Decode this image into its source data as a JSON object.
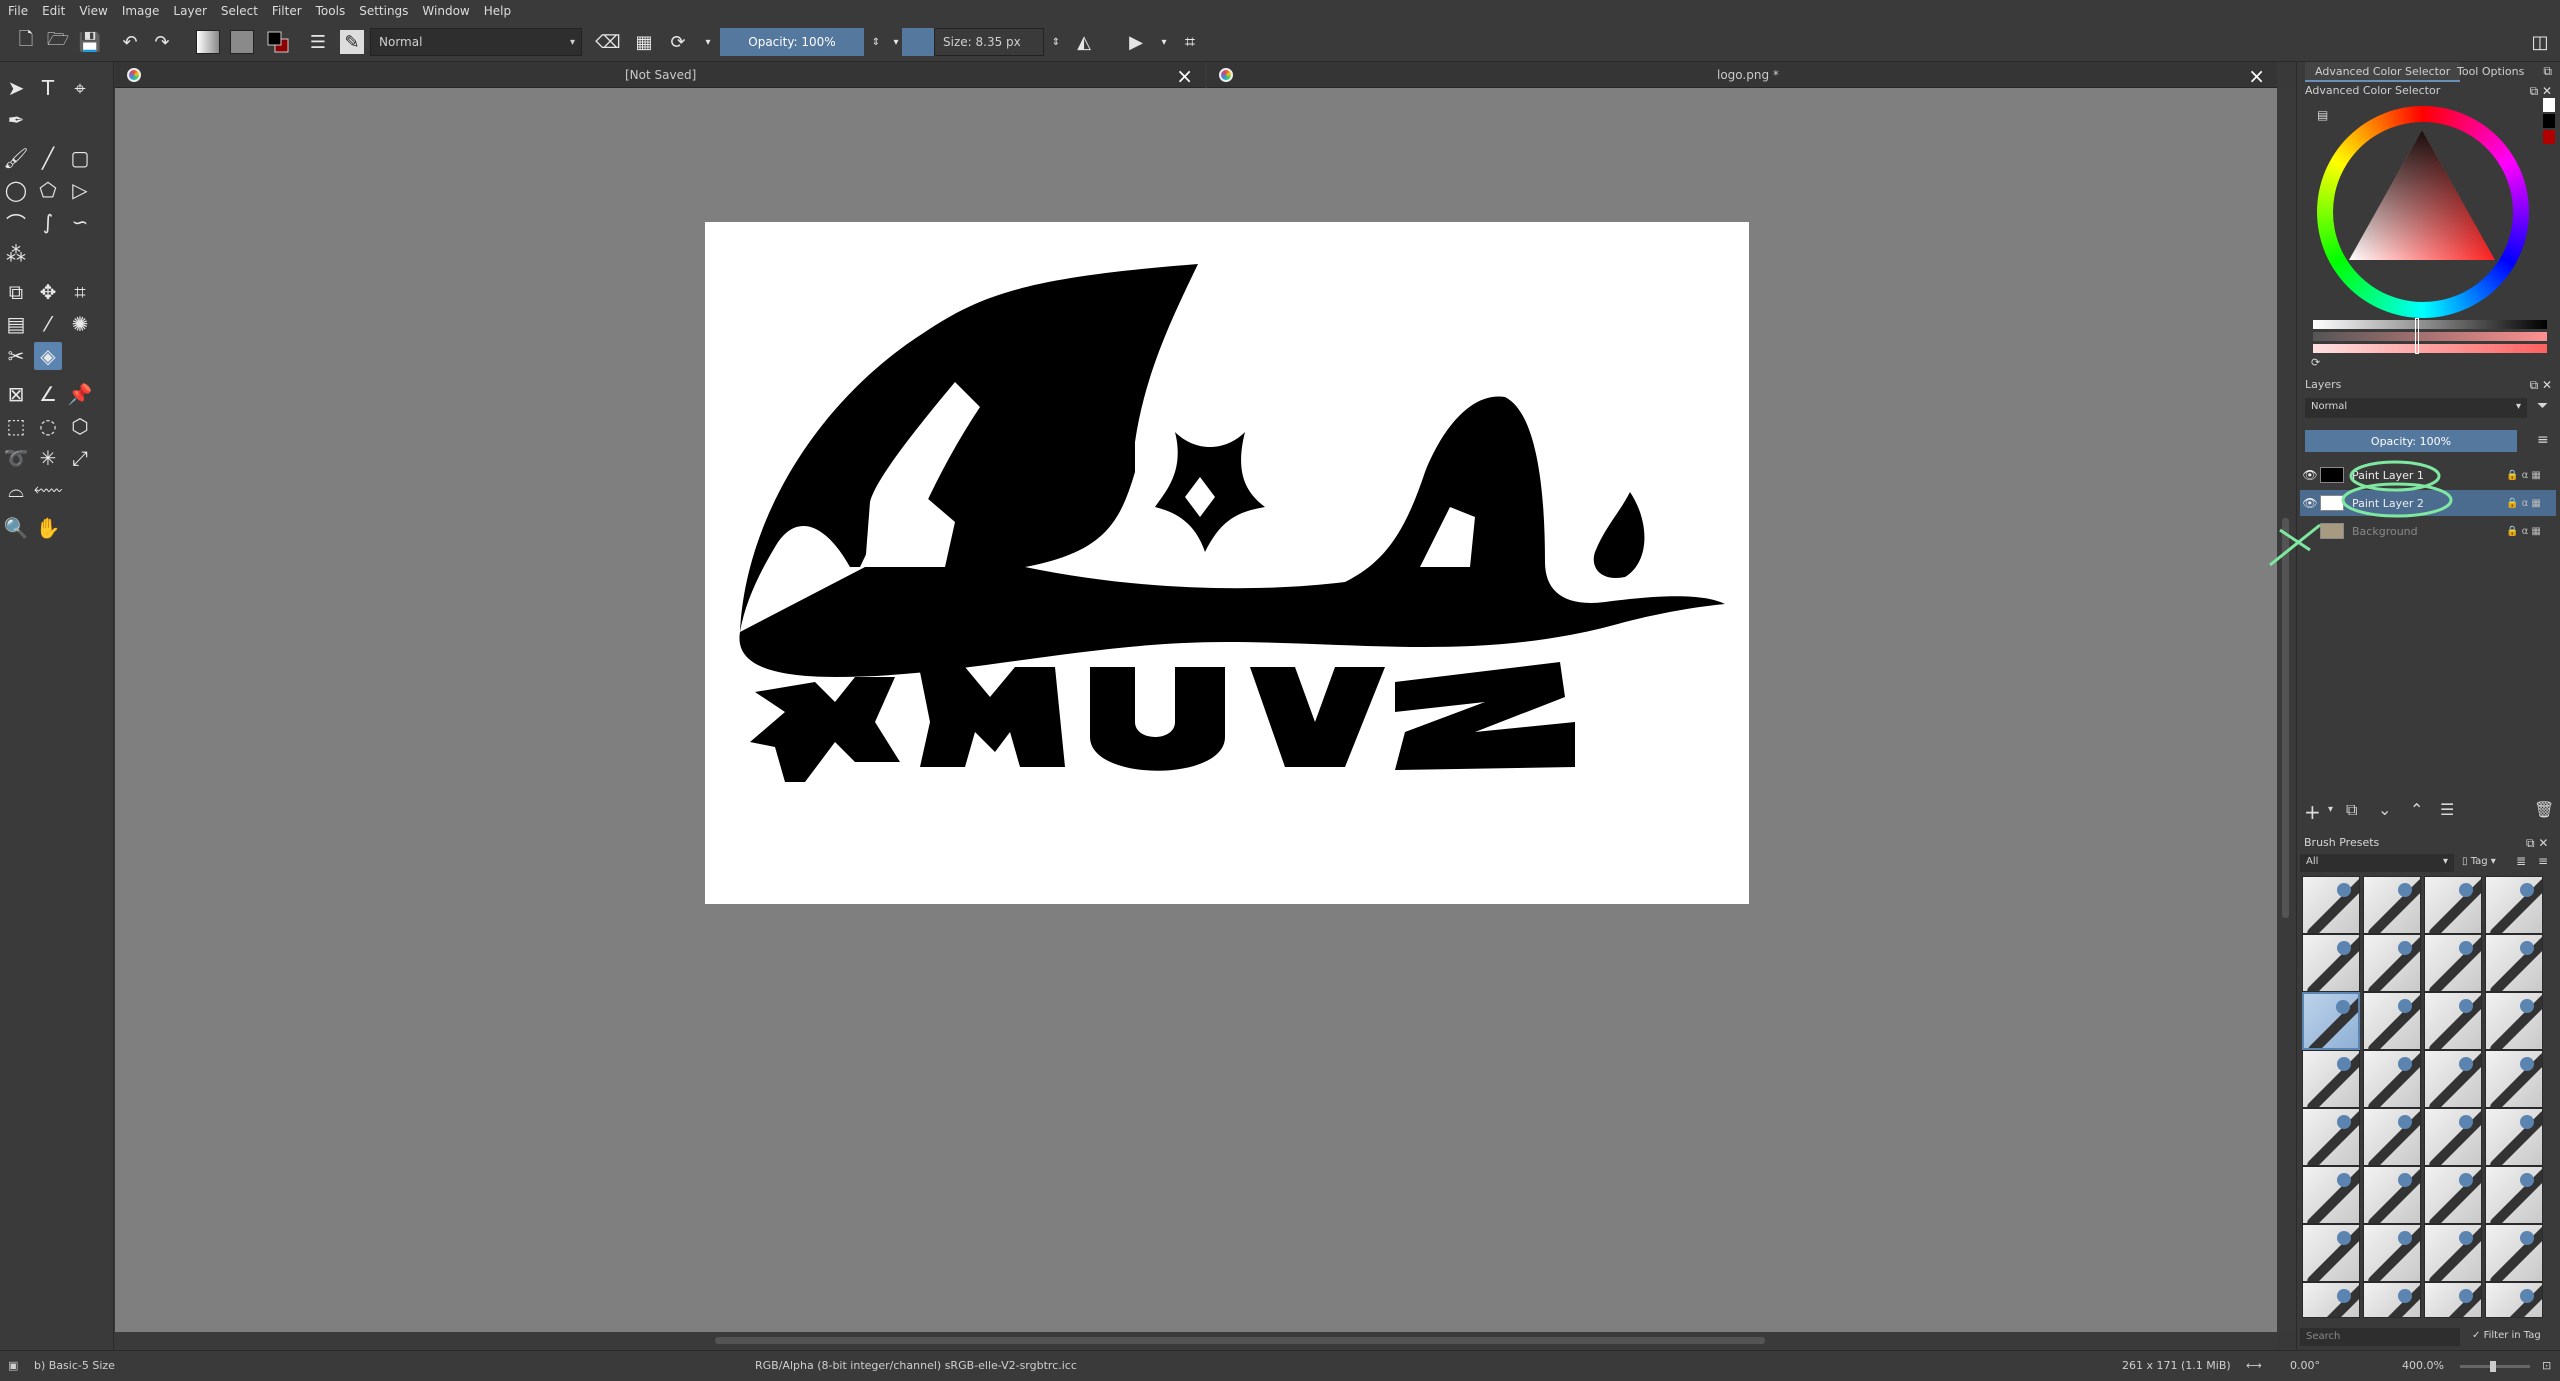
{
  "menu": [
    "File",
    "Edit",
    "View",
    "Image",
    "Layer",
    "Select",
    "Filter",
    "Tools",
    "Settings",
    "Window",
    "Help"
  ],
  "toolbar": {
    "blend_mode": "Normal",
    "opacity_label": "Opacity: 100%",
    "size_label": "Size: 8.35 px"
  },
  "tabs": [
    {
      "title": "[Not Saved]"
    },
    {
      "title": "logo.png *"
    }
  ],
  "dock": {
    "tabs": [
      "Advanced Color Selector",
      "Tool Options"
    ],
    "color_selector_title": "Advanced Color Selector",
    "layers_title": "Layers",
    "layers_blend": "Normal",
    "layers_opacity": "Opacity:  100%",
    "layers": [
      {
        "name": "Paint Layer 1",
        "selected": false
      },
      {
        "name": "Paint Layer 2",
        "selected": true
      },
      {
        "name": "Background",
        "selected": false
      }
    ],
    "brush_presets_title": "Brush Presets",
    "brush_filter": "All",
    "tag_label": "Tag",
    "search_placeholder": "Search",
    "filter_in_tag": "Filter in Tag"
  },
  "statusbar": {
    "brush": "b) Basic-5 Size",
    "color_space": "RGB/Alpha (8-bit integer/channel)  sRGB-elle-V2-srgbtrc.icc",
    "dimensions": "261 x 171 (1.1 MiB)",
    "rotation": "0.00°",
    "zoom": "400.0%"
  },
  "colors": {
    "fg": "#000000",
    "bg": "#ffffff",
    "accent": "#55789e",
    "annotation": "#7fe8a0"
  }
}
